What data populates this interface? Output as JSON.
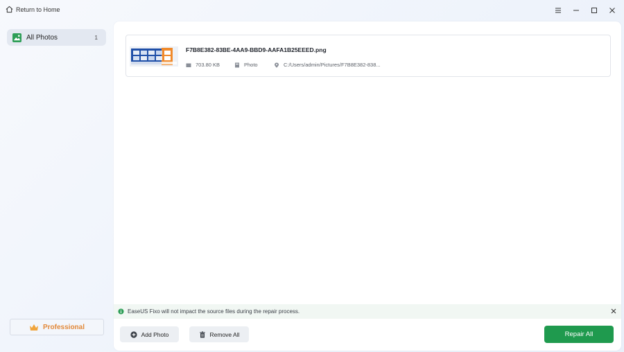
{
  "titlebar": {
    "home_label": "Return to Home",
    "icons": [
      "home-icon",
      "menu-icon",
      "minimize-icon",
      "maximize-icon",
      "close-icon"
    ]
  },
  "sidebar": {
    "items": [
      {
        "label": "All Photos",
        "count": "1",
        "icon": "photo-icon"
      }
    ],
    "upgrade_label": "Professional",
    "upgrade_icon": "crown-icon"
  },
  "files": [
    {
      "name": "F7B8E382-83BE-4AA9-BBD9-AAFA1B25EEED.png",
      "size": "703.80 KB",
      "type": "Photo",
      "path": "C:/Users/admin/Pictures/F7B8E382-838..."
    }
  ],
  "notice": {
    "text": "EaseUS Fixo will not impact the source files during the repair process."
  },
  "actions": {
    "add_label": "Add Photo",
    "remove_label": "Remove All",
    "repair_label": "Repair All"
  },
  "colors": {
    "accent_green": "#1f9a4e",
    "pro_orange": "#e2893a",
    "notice_bg": "#f1f7f3"
  }
}
